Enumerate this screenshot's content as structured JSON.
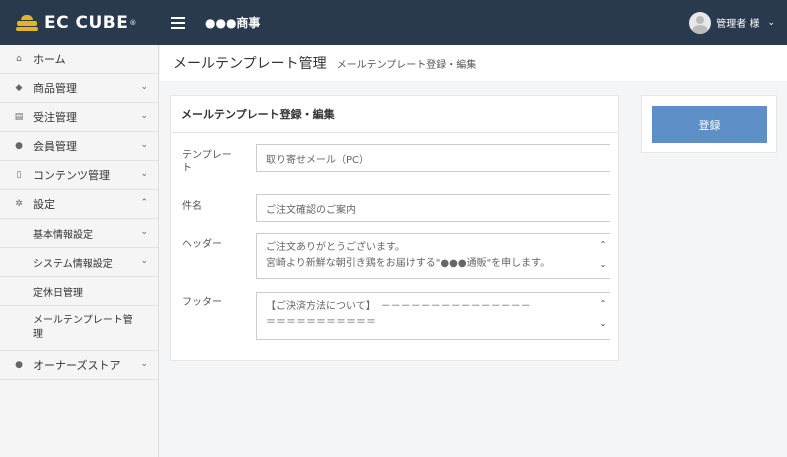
{
  "header": {
    "logo_text": "EC CUBE",
    "logo_reg": "®",
    "shop_name": "●●●商事",
    "user_name": "管理者 様",
    "user_chevron": "⌄"
  },
  "sidebar": {
    "items": [
      {
        "label": "ホーム",
        "icon": "home-icon",
        "glyph": "⌂"
      },
      {
        "label": "商品管理",
        "icon": "tag-icon",
        "glyph": "◆",
        "arrow": "⌄"
      },
      {
        "label": "受注管理",
        "icon": "cart-icon",
        "glyph": "▤",
        "arrow": "⌄"
      },
      {
        "label": "会員管理",
        "icon": "users-icon",
        "glyph": "●",
        "arrow": "⌄"
      },
      {
        "label": "コンテンツ管理",
        "icon": "file-icon",
        "glyph": "▯",
        "arrow": "⌄"
      },
      {
        "label": "設定",
        "icon": "gear-icon",
        "glyph": "✲",
        "arrow": "⌃"
      }
    ],
    "sub_items": [
      {
        "label": "基本情報設定",
        "arrow": "⌄"
      },
      {
        "label": "システム情報設定",
        "arrow": "⌄"
      },
      {
        "label": "定休日管理"
      },
      {
        "label": "メールテンプレート管理"
      }
    ],
    "owner": {
      "label": "オーナーズストア",
      "icon": "store-icon",
      "glyph": "●",
      "arrow": "⌄"
    }
  },
  "page": {
    "title": "メールテンプレート管理",
    "subtitle": "メールテンプレート登録・編集"
  },
  "form": {
    "card_title": "メールテンプレート登録・編集",
    "template_label": "テンプレート",
    "template_value": "取り寄せメール（PC）",
    "subject_label": "件名",
    "subject_value": "ご注文確認のご案内",
    "header_label": "ヘッダー",
    "header_line1": "ご注文ありがとうございます。",
    "header_line2": "宮崎より新鮮な朝引き鶏をお届けする\"●●●通販\"を申します。",
    "footer_label": "フッター",
    "footer_line1": "【ご決済方法について】　－－－－－－－－－－－－－－－",
    "footer_line2": "＝＝＝＝＝＝＝＝＝＝＝",
    "spin_up": "⌃",
    "spin_down": "⌄"
  },
  "actions": {
    "register_label": "登録"
  },
  "colors": {
    "header_bg": "#2a3a4e",
    "accent": "#5e8fc7",
    "logo": "#e6b422"
  }
}
